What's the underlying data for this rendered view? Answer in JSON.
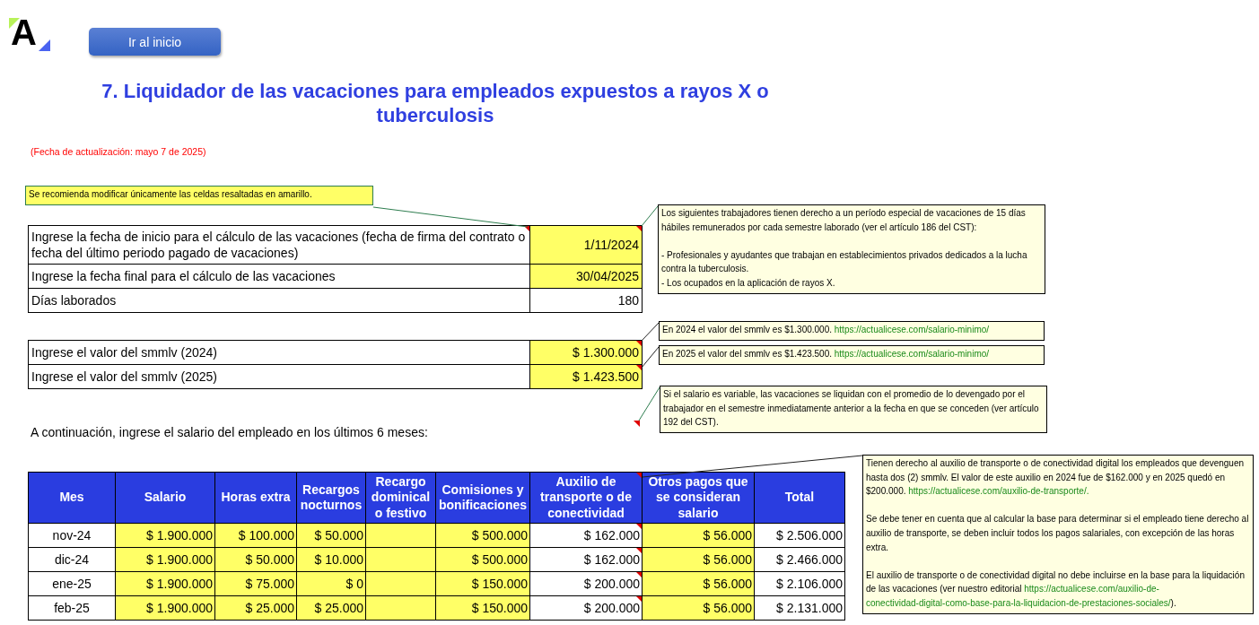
{
  "logo": {
    "text": "A"
  },
  "home_button": {
    "label": "Ir al inicio"
  },
  "title": "7. Liquidador de las vacaciones para empleados expuestos a rayos X o tuberculosis",
  "update_note": "(Fecha de actualización: mayo 7 de 2025)",
  "dates_table": {
    "rows": [
      {
        "label": "Ingrese la fecha de inicio para el cálculo de las vacaciones (fecha de firma del contrato o fecha del último periodo pagado de vacaciones)",
        "value": "1/11/2024",
        "input": true,
        "label_comment": true,
        "value_comment": true
      },
      {
        "label": "Ingrese la fecha final para el cálculo de las vacaciones",
        "value": "30/04/2025",
        "input": true,
        "label_comment": false,
        "value_comment": false
      },
      {
        "label": "Días laborados",
        "value": "180",
        "input": false,
        "label_comment": false,
        "value_comment": false
      }
    ]
  },
  "smmlv_table": {
    "rows": [
      {
        "label": "Ingrese el valor del smmlv (2024)",
        "value": "$ 1.300.000",
        "input": true,
        "label_comment": false,
        "value_comment": true
      },
      {
        "label": "Ingrese el valor del smmlv (2025)",
        "value": "$ 1.423.500",
        "input": true,
        "label_comment": false,
        "value_comment": true
      }
    ]
  },
  "intro": "A continuación, ingrese el salario del empleado en los últimos 6 meses:",
  "salary_table": {
    "columns": [
      {
        "label": "Mes",
        "has_comment": false
      },
      {
        "label": "Salario",
        "has_comment": false
      },
      {
        "label": "Horas extra",
        "has_comment": false
      },
      {
        "label": "Recargos nocturnos",
        "has_comment": false
      },
      {
        "label": "Recargo dominical o festivo",
        "has_comment": false
      },
      {
        "label": "Comisiones y bonificaciones",
        "has_comment": false
      },
      {
        "label": "Auxilio de transporte o de conectividad",
        "has_comment": true
      },
      {
        "label": "Otros pagos que se consideran salario",
        "has_comment": false
      },
      {
        "label": "Total",
        "has_comment": false
      }
    ],
    "rows": [
      {
        "cells": [
          {
            "text": "nov-24",
            "input": false,
            "has_comment": false
          },
          {
            "text": "$ 1.900.000",
            "input": true,
            "has_comment": false
          },
          {
            "text": "$ 100.000",
            "input": true,
            "has_comment": false
          },
          {
            "text": "$ 50.000",
            "input": true,
            "has_comment": false
          },
          {
            "input": true,
            "has_comment": false
          },
          {
            "text": "$ 500.000",
            "input": true,
            "has_comment": false
          },
          {
            "text": "$ 162.000",
            "input": false,
            "has_comment": true
          },
          {
            "text": "$ 56.000",
            "input": true,
            "has_comment": false
          },
          {
            "text": "$ 2.506.000",
            "input": false,
            "has_comment": false
          }
        ]
      },
      {
        "cells": [
          {
            "text": "dic-24",
            "input": false,
            "has_comment": false
          },
          {
            "text": "$ 1.900.000",
            "input": true,
            "has_comment": false
          },
          {
            "text": "$ 50.000",
            "input": true,
            "has_comment": false
          },
          {
            "text": "$ 10.000",
            "input": true,
            "has_comment": false
          },
          {
            "input": true,
            "has_comment": false
          },
          {
            "text": "$ 500.000",
            "input": true,
            "has_comment": false
          },
          {
            "text": "$ 162.000",
            "input": false,
            "has_comment": true
          },
          {
            "text": "$ 56.000",
            "input": true,
            "has_comment": false
          },
          {
            "text": "$ 2.466.000",
            "input": false,
            "has_comment": false
          }
        ]
      },
      {
        "cells": [
          {
            "text": "ene-25",
            "input": false,
            "has_comment": false
          },
          {
            "text": "$ 1.900.000",
            "input": true,
            "has_comment": false
          },
          {
            "text": "$ 75.000",
            "input": true,
            "has_comment": false
          },
          {
            "text": "$ 0",
            "input": true,
            "has_comment": false
          },
          {
            "input": true,
            "has_comment": false
          },
          {
            "text": "$ 150.000",
            "input": true,
            "has_comment": false
          },
          {
            "text": "$ 200.000",
            "input": false,
            "has_comment": true
          },
          {
            "text": "$ 56.000",
            "input": true,
            "has_comment": false
          },
          {
            "text": "$ 2.106.000",
            "input": false,
            "has_comment": false
          }
        ]
      },
      {
        "cells": [
          {
            "text": "feb-25",
            "input": false,
            "has_comment": false
          },
          {
            "text": "$ 1.900.000",
            "input": true,
            "has_comment": false
          },
          {
            "text": "$ 25.000",
            "input": true,
            "has_comment": false
          },
          {
            "text": "$ 25.000",
            "input": true,
            "has_comment": false
          },
          {
            "input": true,
            "has_comment": false
          },
          {
            "text": "$ 150.000",
            "input": true,
            "has_comment": false
          },
          {
            "text": "$ 200.000",
            "input": false,
            "has_comment": true
          },
          {
            "text": "$ 56.000",
            "input": true,
            "has_comment": false
          },
          {
            "text": "$ 2.131.000",
            "input": false,
            "has_comment": false
          }
        ]
      }
    ]
  },
  "comments": [
    {
      "kind": "yellow",
      "paragraphs": [
        [
          {
            "text": "Se recomienda modificar únicamente las celdas resaltadas en amarillo."
          }
        ]
      ]
    },
    {
      "kind": "note",
      "paragraphs": [
        [
          {
            "text": "Los siguientes trabajadores tienen derecho a un período especial de vacaciones de 15 días hábiles remunerados por cada semestre laborado (ver el artículo 186 del CST):"
          }
        ],
        [
          {
            "text": "- Profesionales y ayudantes que trabajan en establecimientos privados dedicados a la lucha contra la tuberculosis."
          },
          {
            "text": "- Los ocupados en la aplicación de rayos X."
          }
        ]
      ]
    },
    {
      "kind": "note",
      "paragraphs": [
        [
          {
            "text": "En 2024 el valor del smmlv es $1.300.000. ",
            "links": [
              "https://actualicese.com/salario-minimo/"
            ]
          }
        ]
      ]
    },
    {
      "kind": "note",
      "paragraphs": [
        [
          {
            "text": "En 2025 el valor del smmlv es $1.423.500. ",
            "links": [
              "https://actualicese.com/salario-minimo/"
            ]
          }
        ]
      ]
    },
    {
      "kind": "note",
      "paragraphs": [
        [
          {
            "text": "Si el salario es variable, las vacaciones se liquidan con el promedio de lo devengado por el trabajador en el semestre inmediatamente anterior a la fecha en que se conceden (ver artículo 192 del CST)."
          }
        ]
      ]
    },
    {
      "kind": "note",
      "paragraphs": [
        [
          {
            "text": "Tienen derecho al auxilio de transporte o de conectividad digital los empleados que devenguen hasta dos (2) smmlv. El valor de este auxilio en 2024 fue de $162.000 y en 2025 quedó en $200.000. ",
            "links": [
              "https://actualicese.com/auxilio-de-transporte/."
            ]
          }
        ],
        [
          {
            "text": "Se debe tener en cuenta que al calcular la base para determinar si el empleado tiene derecho al auxilio de transporte, se deben incluir todos los pagos salariales, con excepción de las horas extra."
          }
        ],
        [
          {
            "text": "El auxilio de transporte o de conectividad digital no debe incluirse en la base para la liquidación de las vacaciones (ver nuestro editorial ",
            "links": [
              "https://actualicese.com/auxilio-de-",
              "conectividad-digital-como-base-para-la-liquidacion-de-prestaciones-sociales/"
            ],
            "after": ")."
          }
        ]
      ]
    }
  ]
}
